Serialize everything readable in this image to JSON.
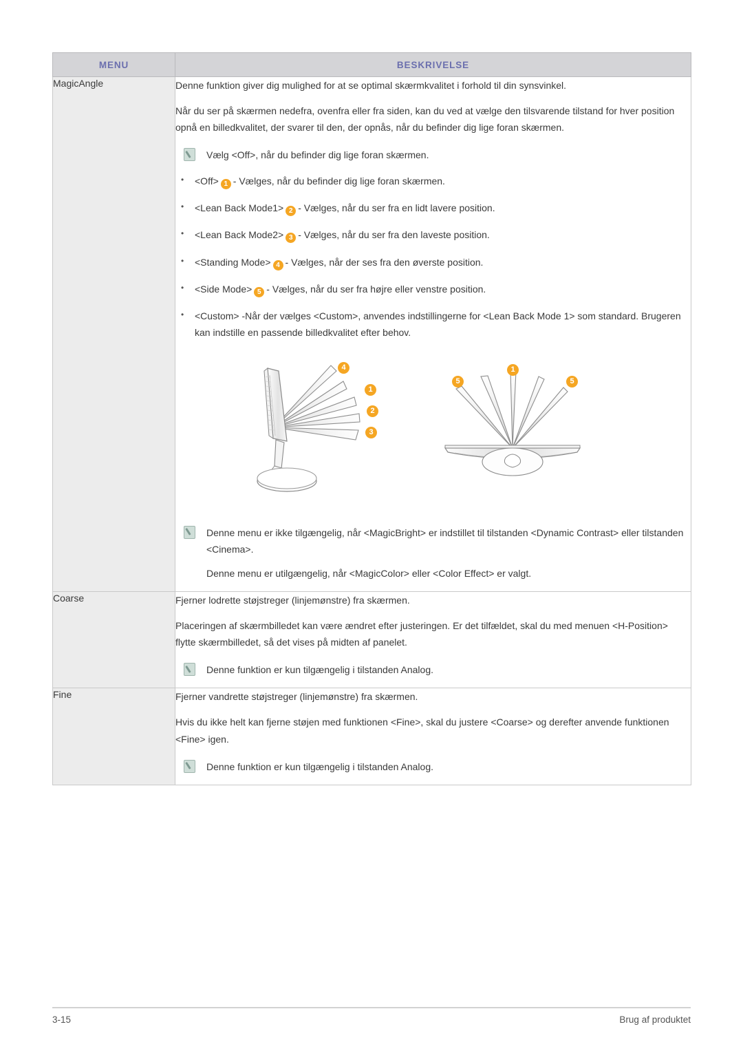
{
  "document": {
    "page_number": "3-15",
    "footer_section": "Brug af produktet"
  },
  "colors": {
    "header_background": "#d4d4d7",
    "header_text": "#6b6fae",
    "menu_column_background": "#ececec",
    "badge_orange": "#f5a623",
    "note_icon": "#cfded8",
    "border": "#c9c9c9"
  },
  "table": {
    "columns": [
      {
        "key": "menu",
        "label": "MENU"
      },
      {
        "key": "beskrivelse",
        "label": "BESKRIVELSE"
      }
    ],
    "rows": [
      {
        "menu": "MagicAngle",
        "paragraphs": [
          "Denne funktion giver dig mulighed for at se optimal skærmkvalitet i forhold til din synsvinkel.",
          "Når du ser på skærmen nedefra, ovenfra eller fra siden, kan du ved at vælge den tilsvarende tilstand for hver position opnå en billedkvalitet, der svarer til den, der opnås, når du befinder dig lige foran skærmen."
        ],
        "note_top": [
          "Vælg <Off>, når du befinder dig lige foran skærmen."
        ],
        "bullets": [
          {
            "option": "<Off>",
            "badge": "1",
            "text": "- Vælges, når du befinder dig lige foran skærmen."
          },
          {
            "option": "<Lean Back Mode1>",
            "badge": "2",
            "text": "- Vælges, når du ser fra en lidt lavere position."
          },
          {
            "option": "<Lean Back Mode2>",
            "badge": "3",
            "text": "- Vælges, når du ser fra den laveste position."
          },
          {
            "option": "<Standing Mode>",
            "badge": "4",
            "text": "- Vælges, når der ses fra den øverste position."
          },
          {
            "option": "<Side Mode>",
            "badge": "5",
            "text": "- Vælges, når du ser fra højre eller venstre position."
          },
          {
            "option": "<Custom>",
            "badge": "",
            "text": "-Når der vælges <Custom>, anvendes indstillingerne for <Lean Back Mode 1> som standard. Brugeren kan indstille en passende billedkvalitet efter behov."
          }
        ],
        "figures": {
          "side_view": {
            "caption": "monitor-side-view-viewing-angles",
            "badges": [
              "4",
              "1",
              "2",
              "3"
            ]
          },
          "top_view": {
            "caption": "monitor-top-view-viewing-angles",
            "badges": [
              "5",
              "1",
              "5"
            ]
          }
        },
        "note_bottom": [
          "Denne menu er ikke tilgængelig, når <MagicBright> er indstillet til tilstanden <Dynamic Contrast> eller tilstanden <Cinema>.",
          "Denne menu er utilgængelig, når <MagicColor> eller <Color Effect> er valgt."
        ]
      },
      {
        "menu": "Coarse",
        "paragraphs": [
          "Fjerner lodrette støjstreger (linjemønstre) fra skærmen.",
          "Placeringen af skærmbilledet kan være ændret efter justeringen. Er det tilfældet, skal du med menuen <H-Position> flytte skærmbilledet, så det vises på midten af panelet."
        ],
        "note_bottom": [
          "Denne funktion er kun tilgængelig i tilstanden Analog."
        ]
      },
      {
        "menu": "Fine",
        "paragraphs": [
          "Fjerner vandrette støjstreger (linjemønstre) fra skærmen.",
          "Hvis du ikke helt kan fjerne støjen med funktionen <Fine>, skal du justere <Coarse> og derefter anvende funktionen <Fine> igen."
        ],
        "note_bottom": [
          "Denne funktion er kun tilgængelig i tilstanden Analog."
        ]
      }
    ]
  }
}
